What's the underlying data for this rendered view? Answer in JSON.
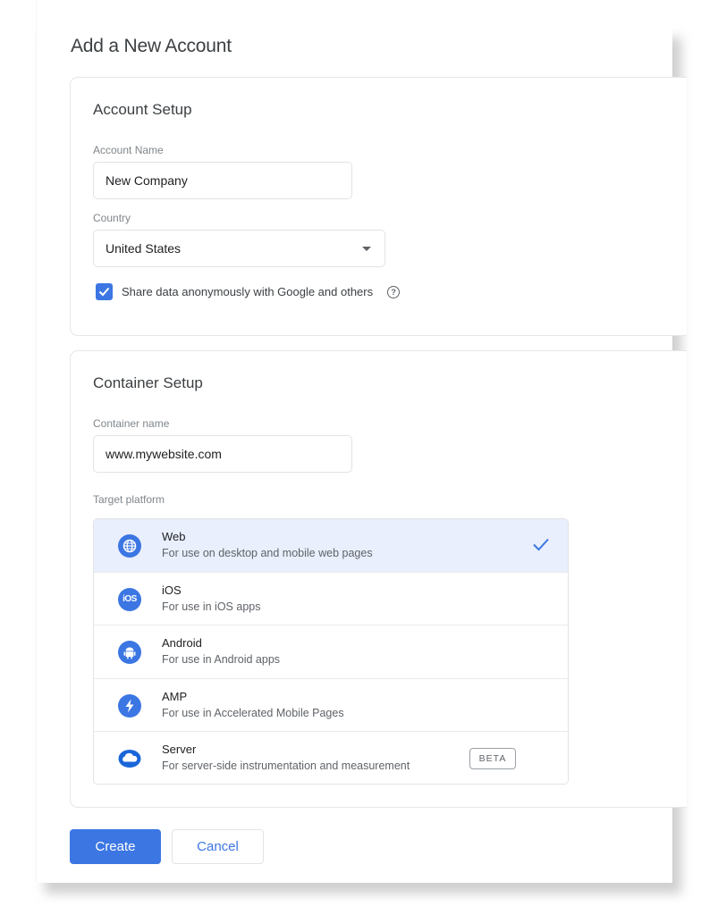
{
  "page": {
    "title": "Add a New Account"
  },
  "account_setup": {
    "title": "Account Setup",
    "account_name": {
      "label": "Account Name",
      "value": "New Company"
    },
    "country": {
      "label": "Country",
      "selected": "United States"
    },
    "share_data": {
      "label": "Share data anonymously with Google and others",
      "checked": true,
      "help_icon": "help-circle-icon"
    }
  },
  "container_setup": {
    "title": "Container Setup",
    "container_name": {
      "label": "Container name",
      "value": "www.mywebsite.com"
    },
    "target_platform": {
      "label": "Target platform",
      "selected": "Web",
      "options": [
        {
          "name": "Web",
          "description": "For use on desktop and mobile web pages",
          "icon": "globe-icon"
        },
        {
          "name": "iOS",
          "description": "For use in iOS apps",
          "icon": "ios-icon",
          "icon_text": "iOS"
        },
        {
          "name": "Android",
          "description": "For use in Android apps",
          "icon": "android-icon"
        },
        {
          "name": "AMP",
          "description": "For use in Accelerated Mobile Pages",
          "icon": "lightning-bolt-icon"
        },
        {
          "name": "Server",
          "description": "For server-side instrumentation and measurement",
          "icon": "cloud-icon",
          "badge": "BETA"
        }
      ]
    }
  },
  "actions": {
    "create_label": "Create",
    "cancel_label": "Cancel"
  },
  "colors": {
    "accent": "#3b76e3",
    "selected_row": "#e9effc"
  }
}
